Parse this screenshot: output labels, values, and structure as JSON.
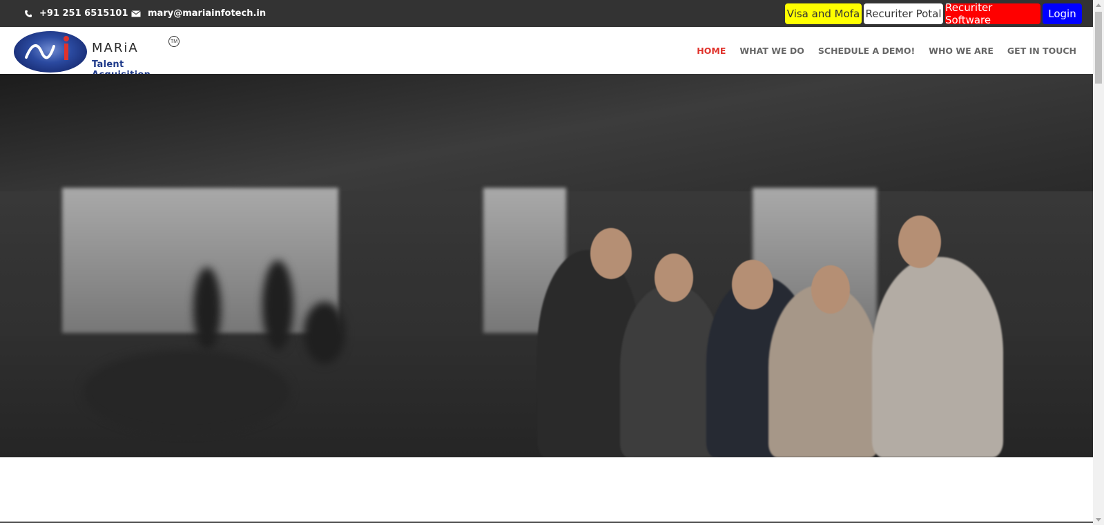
{
  "topbar": {
    "phone": "+91 251 6515101",
    "email": "mary@mariainfotech.in",
    "buttons": {
      "visa": "Visa and Mofa",
      "potal": "Recuriter Potal",
      "software": "Recuriter Software",
      "login": "Login"
    },
    "colors": {
      "visa": "#ffff00",
      "potal": "#ffffff",
      "software": "#ff0000",
      "login": "#0000ff"
    }
  },
  "logo": {
    "name": "MARiA",
    "tagline": "Talent Acquisition",
    "trademark": "TM"
  },
  "nav": {
    "items": [
      {
        "label": "HOME",
        "active": true
      },
      {
        "label": "WHAT WE DO",
        "active": false
      },
      {
        "label": "SCHEDULE A DEMO!",
        "active": false
      },
      {
        "label": "WHO WE ARE",
        "active": false
      },
      {
        "label": "GET IN TOUCH",
        "active": false
      }
    ],
    "active_color": "#e0322b"
  }
}
